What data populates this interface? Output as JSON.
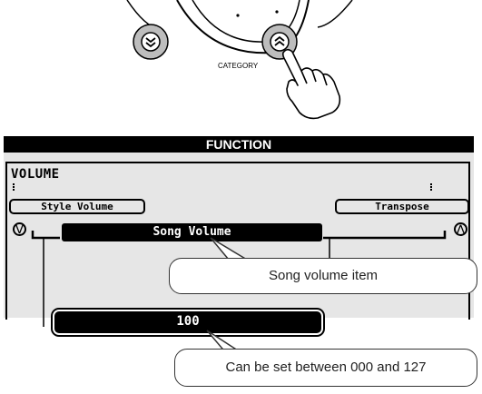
{
  "top": {
    "category_label": "CATEGORY"
  },
  "lcd": {
    "header": "FUNCTION",
    "mode": "VOLUME",
    "prev_item": "Style Volume",
    "next_item": "Transpose",
    "current_item": "Song Volume",
    "value": "100"
  },
  "callouts": {
    "item": "Song volume item",
    "range": "Can be set between 000 and 127"
  },
  "icons": {
    "down_button": "double-chevron-down-icon",
    "up_button": "double-chevron-up-icon",
    "hand": "pointing-hand-icon"
  }
}
